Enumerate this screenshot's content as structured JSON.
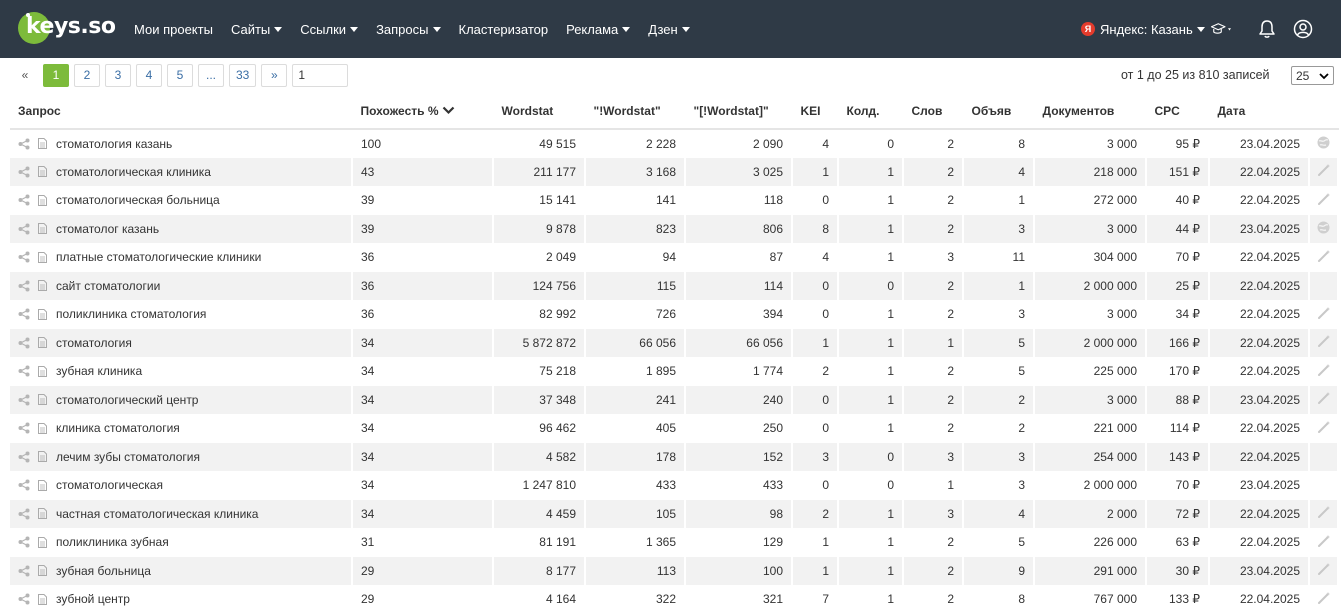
{
  "brand": {
    "logo_text": "keys.so",
    "accent": "#7dbb3b",
    "header_bg": "#2f3a46"
  },
  "nav": [
    {
      "label": "Мои проекты",
      "dropdown": false
    },
    {
      "label": "Сайты",
      "dropdown": true
    },
    {
      "label": "Ссылки",
      "dropdown": true
    },
    {
      "label": "Запросы",
      "dropdown": true
    },
    {
      "label": "Кластеризатор",
      "dropdown": false
    },
    {
      "label": "Реклама",
      "dropdown": true
    },
    {
      "label": "Дзен",
      "dropdown": true
    }
  ],
  "region": {
    "badge": "Я",
    "label": "Яндекс: Казань"
  },
  "header_icons": [
    "graduation-cap-icon",
    "bell-icon",
    "user-icon"
  ],
  "pagination": {
    "prev": "«",
    "pages": [
      "1",
      "2",
      "3",
      "4",
      "5",
      "...",
      "33"
    ],
    "active": "1",
    "next": "»",
    "goto_value": "1"
  },
  "records_text": "от 1 до 25 из 810 записей",
  "per_page": "25",
  "columns": [
    "Запрос",
    "Похожесть %",
    "Wordstat",
    "\"!Wordstat\"",
    "\"[!Wordstat]\"",
    "KEI",
    "Колд.",
    "Слов",
    "Объяв",
    "Документов",
    "CPC",
    "Дата"
  ],
  "rows": [
    {
      "q": "стоматология казань",
      "sim": "100",
      "ws": "49 515",
      "ws2": "2 228",
      "ws3": "2 090",
      "kei": "4",
      "kold": "0",
      "words": "2",
      "ads": "8",
      "docs": "3 000",
      "cpc": "95 ₽",
      "date": "23.04.2025",
      "action": "globe-icon"
    },
    {
      "q": "стоматологическая клиника",
      "sim": "43",
      "ws": "211 177",
      "ws2": "3 168",
      "ws3": "3 025",
      "kei": "1",
      "kold": "1",
      "words": "2",
      "ads": "4",
      "docs": "218 000",
      "cpc": "151 ₽",
      "date": "22.04.2025",
      "action": "wand-icon"
    },
    {
      "q": "стоматологическая больница",
      "sim": "39",
      "ws": "15 141",
      "ws2": "141",
      "ws3": "118",
      "kei": "0",
      "kold": "1",
      "words": "2",
      "ads": "1",
      "docs": "272 000",
      "cpc": "40 ₽",
      "date": "22.04.2025",
      "action": "wand-icon"
    },
    {
      "q": "стоматолог казань",
      "sim": "39",
      "ws": "9 878",
      "ws2": "823",
      "ws3": "806",
      "kei": "8",
      "kold": "1",
      "words": "2",
      "ads": "3",
      "docs": "3 000",
      "cpc": "44 ₽",
      "date": "23.04.2025",
      "action": "globe-icon"
    },
    {
      "q": "платные стоматологические клиники",
      "sim": "36",
      "ws": "2 049",
      "ws2": "94",
      "ws3": "87",
      "kei": "4",
      "kold": "1",
      "words": "3",
      "ads": "11",
      "docs": "304 000",
      "cpc": "70 ₽",
      "date": "22.04.2025",
      "action": "wand-icon"
    },
    {
      "q": "сайт стоматологии",
      "sim": "36",
      "ws": "124 756",
      "ws2": "115",
      "ws3": "114",
      "kei": "0",
      "kold": "0",
      "words": "2",
      "ads": "1",
      "docs": "2 000 000",
      "cpc": "25 ₽",
      "date": "22.04.2025",
      "action": ""
    },
    {
      "q": "поликлиника стоматология",
      "sim": "36",
      "ws": "82 992",
      "ws2": "726",
      "ws3": "394",
      "kei": "0",
      "kold": "1",
      "words": "2",
      "ads": "3",
      "docs": "3 000",
      "cpc": "34 ₽",
      "date": "22.04.2025",
      "action": "wand-icon"
    },
    {
      "q": "стоматология",
      "sim": "34",
      "ws": "5 872 872",
      "ws2": "66 056",
      "ws3": "66 056",
      "kei": "1",
      "kold": "1",
      "words": "1",
      "ads": "5",
      "docs": "2 000 000",
      "cpc": "166 ₽",
      "date": "22.04.2025",
      "action": "wand-icon"
    },
    {
      "q": "зубная клиника",
      "sim": "34",
      "ws": "75 218",
      "ws2": "1 895",
      "ws3": "1 774",
      "kei": "2",
      "kold": "1",
      "words": "2",
      "ads": "5",
      "docs": "225 000",
      "cpc": "170 ₽",
      "date": "22.04.2025",
      "action": "wand-icon"
    },
    {
      "q": "стоматологический центр",
      "sim": "34",
      "ws": "37 348",
      "ws2": "241",
      "ws3": "240",
      "kei": "0",
      "kold": "1",
      "words": "2",
      "ads": "2",
      "docs": "3 000",
      "cpc": "88 ₽",
      "date": "23.04.2025",
      "action": "wand-icon"
    },
    {
      "q": "клиника стоматология",
      "sim": "34",
      "ws": "96 462",
      "ws2": "405",
      "ws3": "250",
      "kei": "0",
      "kold": "1",
      "words": "2",
      "ads": "2",
      "docs": "221 000",
      "cpc": "114 ₽",
      "date": "22.04.2025",
      "action": "wand-icon"
    },
    {
      "q": "лечим зубы стоматология",
      "sim": "34",
      "ws": "4 582",
      "ws2": "178",
      "ws3": "152",
      "kei": "3",
      "kold": "0",
      "words": "3",
      "ads": "3",
      "docs": "254 000",
      "cpc": "143 ₽",
      "date": "22.04.2025",
      "action": ""
    },
    {
      "q": "стоматологическая",
      "sim": "34",
      "ws": "1 247 810",
      "ws2": "433",
      "ws3": "433",
      "kei": "0",
      "kold": "0",
      "words": "1",
      "ads": "3",
      "docs": "2 000 000",
      "cpc": "70 ₽",
      "date": "23.04.2025",
      "action": ""
    },
    {
      "q": "частная стоматологическая клиника",
      "sim": "34",
      "ws": "4 459",
      "ws2": "105",
      "ws3": "98",
      "kei": "2",
      "kold": "1",
      "words": "3",
      "ads": "4",
      "docs": "2 000",
      "cpc": "72 ₽",
      "date": "22.04.2025",
      "action": "wand-icon"
    },
    {
      "q": "поликлиника зубная",
      "sim": "31",
      "ws": "81 191",
      "ws2": "1 365",
      "ws3": "129",
      "kei": "1",
      "kold": "1",
      "words": "2",
      "ads": "5",
      "docs": "226 000",
      "cpc": "63 ₽",
      "date": "22.04.2025",
      "action": "wand-icon"
    },
    {
      "q": "зубная больница",
      "sim": "29",
      "ws": "8 177",
      "ws2": "113",
      "ws3": "100",
      "kei": "1",
      "kold": "1",
      "words": "2",
      "ads": "9",
      "docs": "291 000",
      "cpc": "30 ₽",
      "date": "23.04.2025",
      "action": "wand-icon"
    },
    {
      "q": "зубной центр",
      "sim": "29",
      "ws": "4 164",
      "ws2": "322",
      "ws3": "321",
      "kei": "7",
      "kold": "1",
      "words": "2",
      "ads": "8",
      "docs": "767 000",
      "cpc": "133 ₽",
      "date": "22.04.2025",
      "action": "wand-icon"
    }
  ]
}
